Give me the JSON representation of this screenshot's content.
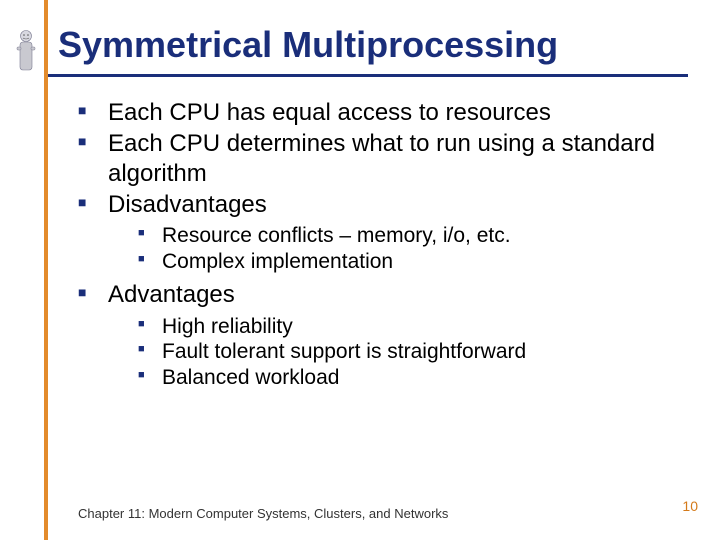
{
  "title": "Symmetrical Multiprocessing",
  "bullets": {
    "b0": "Each CPU has equal access to resources",
    "b1": "Each CPU determines what to run using a standard algorithm",
    "b2": "Disadvantages",
    "b2_sub": {
      "s0": "Resource conflicts – memory, i/o, etc.",
      "s1": "Complex implementation"
    },
    "b3": "Advantages",
    "b3_sub": {
      "s0": "High reliability",
      "s1": "Fault tolerant support is straightforward",
      "s2": "Balanced workload"
    }
  },
  "footer": {
    "chapter": "Chapter 11: Modern Computer Systems, Clusters, and Networks",
    "page": "10"
  }
}
